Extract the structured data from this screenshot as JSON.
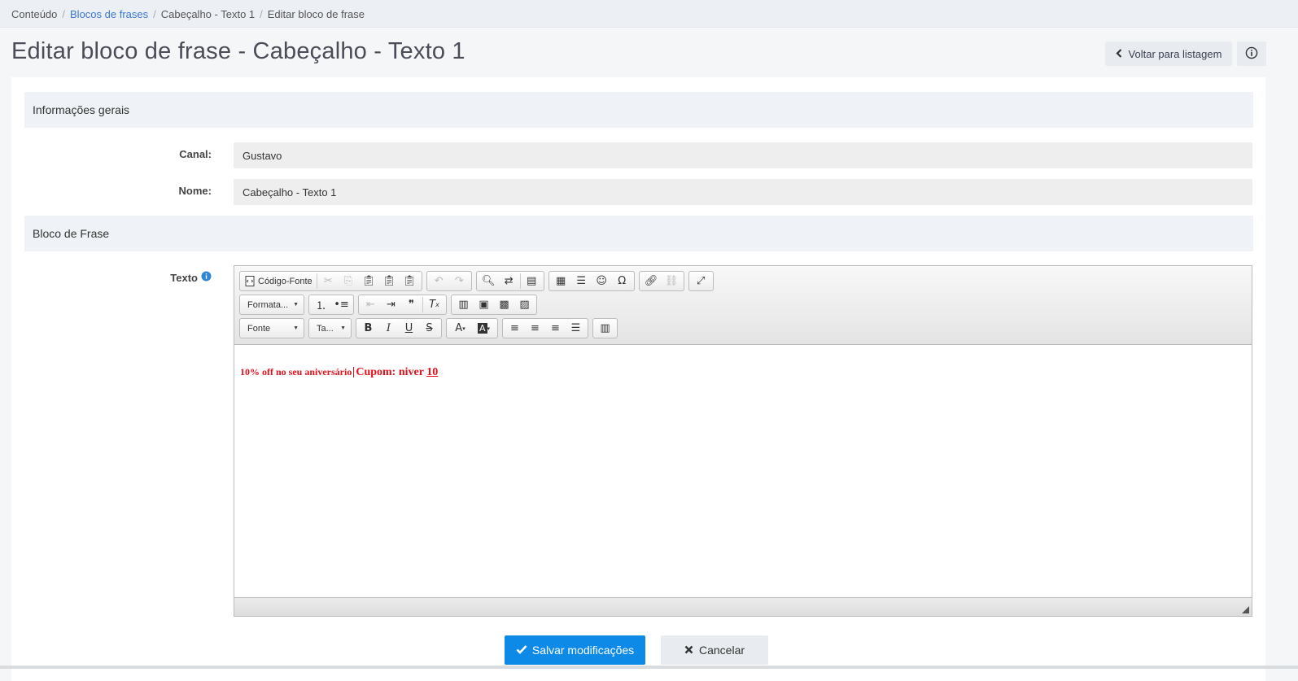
{
  "breadcrumb": {
    "items": [
      "Conteúdo",
      "Blocos de frases",
      "Cabeçalho - Texto 1",
      "Editar bloco de frase"
    ],
    "separator": "/"
  },
  "page": {
    "title": "Editar bloco de frase - Cabeçalho - Texto 1",
    "back_label": "Voltar para listagem"
  },
  "sections": {
    "general": "Informações gerais",
    "block": "Bloco de Frase"
  },
  "fields": {
    "canal_label": "Canal:",
    "canal_value": "Gustavo",
    "nome_label": "Nome:",
    "nome_value": "Cabeçalho - Texto 1",
    "texto_label": "Texto"
  },
  "editor": {
    "source_label": "Código-Fonte",
    "format_combo": "Formata...",
    "font_combo": "Fonte",
    "size_combo": "Ta...",
    "content": {
      "part1": "10% off no seu aniversário",
      "part2": "Cupom: niver ",
      "part3": "10"
    },
    "content_color": "#e8101a"
  },
  "actions": {
    "save_label": "Salvar modificações",
    "cancel_label": "Cancelar"
  },
  "colors": {
    "primary": "#0d8ae8",
    "link": "#3b77d6"
  }
}
